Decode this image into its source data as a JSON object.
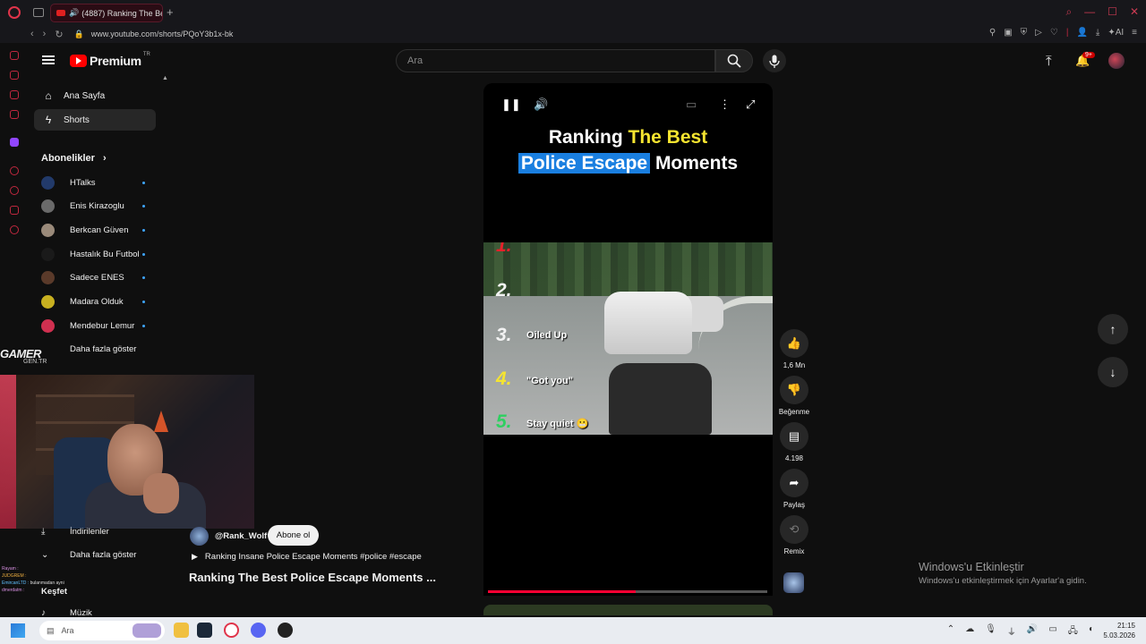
{
  "browser": {
    "tab_title": "(4887) Ranking The Be",
    "url": "www.youtube.com/shorts/PQoY3b1x-bk"
  },
  "header": {
    "logo_text": "Premium",
    "logo_region": "TR",
    "search_placeholder": "Ara",
    "notifications_badge": "9+"
  },
  "sidebar": {
    "home_label": "Ana Sayfa",
    "shorts_label": "Shorts",
    "subscriptions_heading": "Abonelikler",
    "subscriptions": [
      {
        "name": "HTalks",
        "color": "#223a6a"
      },
      {
        "name": "Enis Kirazoglu",
        "color": "#6a6a6a"
      },
      {
        "name": "Berkcan Güven",
        "color": "#9a8a7a"
      },
      {
        "name": "Hastalık Bu Futbol",
        "color": "#1a1a1a"
      },
      {
        "name": "Sadece ENES",
        "color": "#5a3a2a"
      },
      {
        "name": "Madara Olduk",
        "color": "#c8b020"
      },
      {
        "name": "Mendebur Lemur",
        "color": "#d03050"
      }
    ],
    "show_more_label": "Daha fazla göster",
    "downloads_label": "İndirilenler",
    "show_more_label_2": "Daha fazla göster",
    "keşfet_label": "Keşfet",
    "music_label": "Müzik"
  },
  "overlay": {
    "logo_line1": "GAMER",
    "logo_line2": "GEN.TR",
    "chat": [
      {
        "user": "Rayam :",
        "text": ""
      },
      {
        "user": "JUDGREM :",
        "text": ""
      },
      {
        "user": "EmircanLTD :",
        "text": "bulanmadan ayni"
      },
      {
        "user": "dmerdatm :",
        "text": ""
      },
      {
        "user": "",
        "text": ""
      }
    ]
  },
  "short": {
    "title_part1": "Ranking ",
    "title_part2": "The Best",
    "title_part3": "Police Escape",
    "title_part4": " Moments",
    "ranks": [
      {
        "num": "1.",
        "color": "#e8202a",
        "label": ""
      },
      {
        "num": "2.",
        "color": "#f2f2f2",
        "label": ""
      },
      {
        "num": "3.",
        "color": "#f2f2f2",
        "label": "Oiled Up"
      },
      {
        "num": "4.",
        "color": "#f5e430",
        "label": "\"Got you\""
      },
      {
        "num": "5.",
        "color": "#2ed060",
        "label": "Stay quiet 😬"
      }
    ],
    "progress": 0.53,
    "channel": "@Rank_Wolf",
    "subscribe_label": "Abone ol",
    "description": "Ranking Insane Police Escape Moments #police #escape",
    "video_title": "Ranking The Best Police Escape Moments ..."
  },
  "actions": {
    "like_count": "1,6 Mn",
    "dislike_label": "Beğenme",
    "comment_count": "4.198",
    "share_label": "Paylaş",
    "remix_label": "Remix"
  },
  "windows": {
    "activate_title": "Windows'u Etkinleştir",
    "activate_sub": "Windows'u etkinleştirmek için Ayarlar'a gidin.",
    "taskbar_search": "Ara",
    "time": "21:15",
    "date": "5.03.2026"
  }
}
